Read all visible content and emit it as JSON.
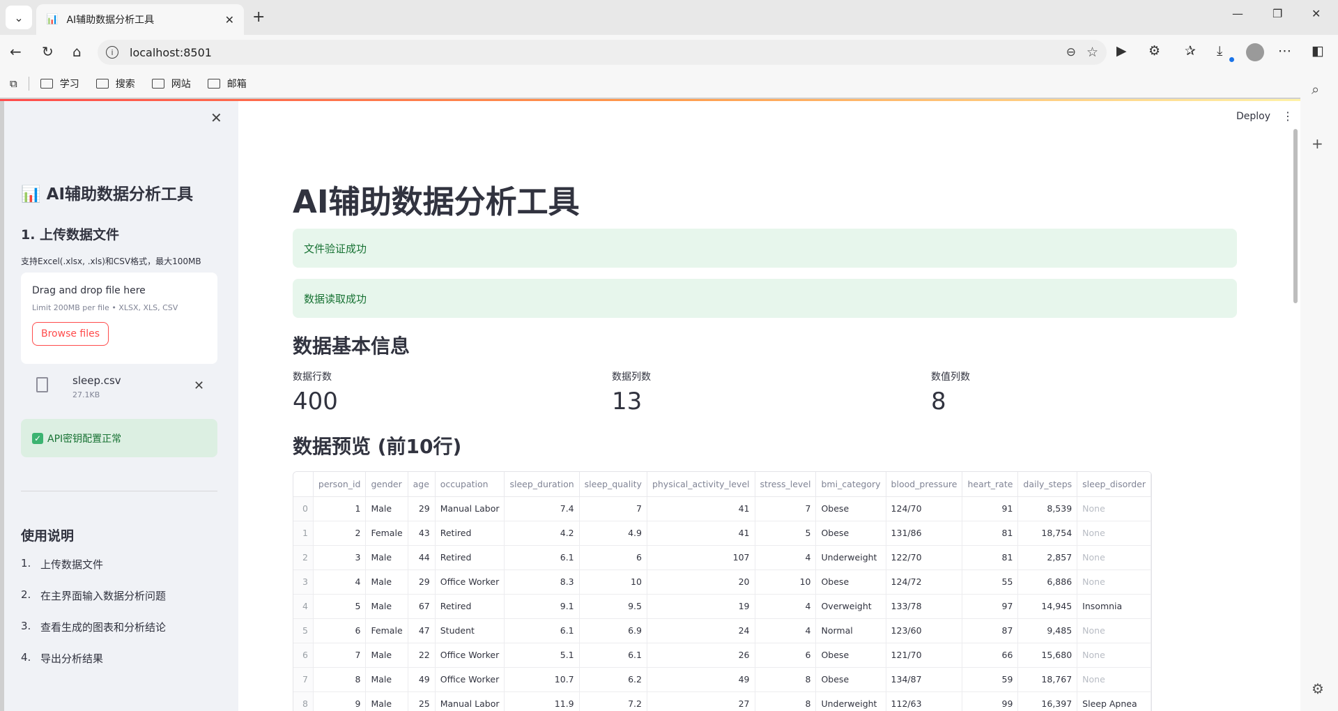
{
  "browser": {
    "tab_title": "AI辅助数据分析工具",
    "url": "localhost:8501",
    "bookmarks": [
      "学习",
      "搜索",
      "网站",
      "邮箱"
    ]
  },
  "app": {
    "deploy_label": "Deploy",
    "sidebar": {
      "title": "AI辅助数据分析工具",
      "upload_heading": "1. 上传数据文件",
      "upload_caption": "支持Excel(.xlsx, .xls)和CSV格式，最大100MB",
      "dropzone_text": "Drag and drop file here",
      "dropzone_limit": "Limit 200MB per file • XLSX, XLS, CSV",
      "browse_label": "Browse files",
      "file_name": "sleep.csv",
      "file_size": "27.1KB",
      "api_status": "API密钥配置正常",
      "usage_heading": "使用说明",
      "usage_steps": [
        "上传数据文件",
        "在主界面输入数据分析问题",
        "查看生成的图表和分析结论",
        "导出分析结果"
      ]
    },
    "main": {
      "title": "AI辅助数据分析工具",
      "alert_validate": "文件验证成功",
      "alert_read": "数据读取成功",
      "basic_info_heading": "数据基本信息",
      "metrics": [
        {
          "label": "数据行数",
          "value": "400"
        },
        {
          "label": "数据列数",
          "value": "13"
        },
        {
          "label": "数值列数",
          "value": "8"
        }
      ],
      "preview_heading": "数据预览 (前10行)",
      "table": {
        "columns": [
          "",
          "person_id",
          "gender",
          "age",
          "occupation",
          "sleep_duration",
          "sleep_quality",
          "physical_activity_level",
          "stress_level",
          "bmi_category",
          "blood_pressure",
          "heart_rate",
          "daily_steps",
          "sleep_disorder"
        ],
        "rows": [
          [
            "0",
            "1",
            "Male",
            "29",
            "Manual Labor",
            "7.4",
            "7",
            "41",
            "7",
            "Obese",
            "124/70",
            "91",
            "8,539",
            "None"
          ],
          [
            "1",
            "2",
            "Female",
            "43",
            "Retired",
            "4.2",
            "4.9",
            "41",
            "5",
            "Obese",
            "131/86",
            "81",
            "18,754",
            "None"
          ],
          [
            "2",
            "3",
            "Male",
            "44",
            "Retired",
            "6.1",
            "6",
            "107",
            "4",
            "Underweight",
            "122/70",
            "81",
            "2,857",
            "None"
          ],
          [
            "3",
            "4",
            "Male",
            "29",
            "Office Worker",
            "8.3",
            "10",
            "20",
            "10",
            "Obese",
            "124/72",
            "55",
            "6,886",
            "None"
          ],
          [
            "4",
            "5",
            "Male",
            "67",
            "Retired",
            "9.1",
            "9.5",
            "19",
            "4",
            "Overweight",
            "133/78",
            "97",
            "14,945",
            "Insomnia"
          ],
          [
            "5",
            "6",
            "Female",
            "47",
            "Student",
            "6.1",
            "6.9",
            "24",
            "4",
            "Normal",
            "123/60",
            "87",
            "9,485",
            "None"
          ],
          [
            "6",
            "7",
            "Male",
            "22",
            "Office Worker",
            "5.1",
            "6.1",
            "26",
            "6",
            "Obese",
            "121/70",
            "66",
            "15,680",
            "None"
          ],
          [
            "7",
            "8",
            "Male",
            "49",
            "Office Worker",
            "10.7",
            "6.2",
            "49",
            "8",
            "Obese",
            "134/87",
            "59",
            "18,767",
            "None"
          ],
          [
            "8",
            "9",
            "Male",
            "25",
            "Manual Labor",
            "11.9",
            "7.2",
            "27",
            "8",
            "Underweight",
            "112/63",
            "99",
            "16,397",
            "Sleep Apnea"
          ]
        ]
      }
    }
  }
}
